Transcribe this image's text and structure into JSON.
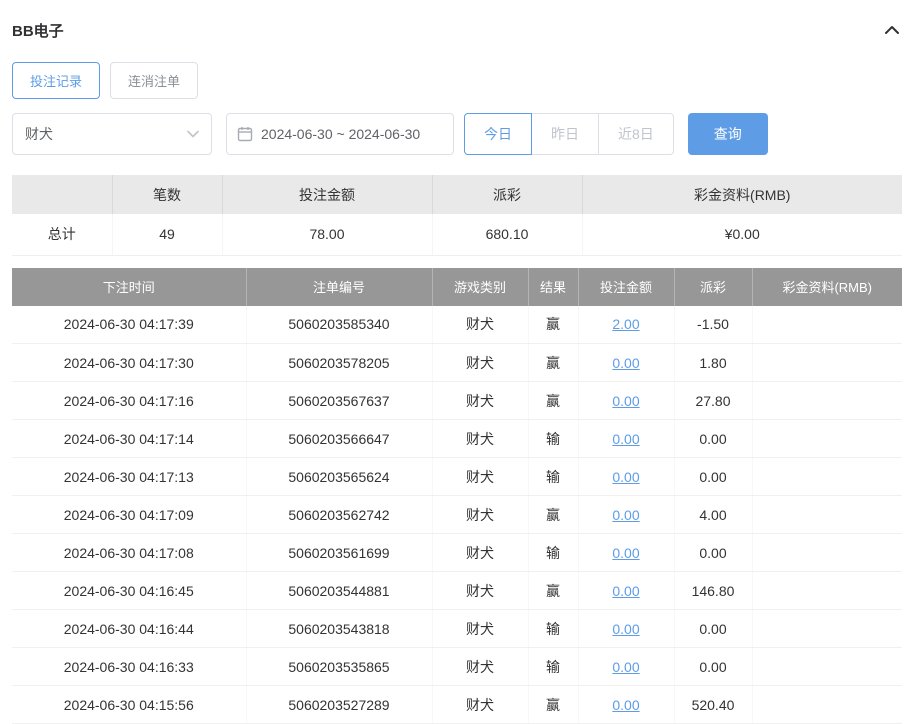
{
  "page": {
    "title": "BB电子"
  },
  "icons": {
    "collapse": "chevron-up",
    "calendar": "calendar",
    "select_arrow": "chevron-down"
  },
  "colors": {
    "accent": "#5e9de6",
    "negative": "#e05c5c",
    "table_header_bg": "#979797"
  },
  "tabs": [
    {
      "label": "投注记录",
      "active": true
    },
    {
      "label": "连消注单",
      "active": false
    }
  ],
  "filters": {
    "game_select": {
      "value": "财犬"
    },
    "date_range": {
      "value": "2024-06-30 ~ 2024-06-30"
    },
    "quick_buttons": [
      {
        "label": "今日",
        "active": true
      },
      {
        "label": "昨日",
        "active": false
      },
      {
        "label": "近8日",
        "active": false
      }
    ],
    "search_button": "查询"
  },
  "summary": {
    "headers": [
      "",
      "笔数",
      "投注金额",
      "派彩",
      "彩金资料(RMB)"
    ],
    "total": {
      "label": "总计",
      "count": "49",
      "bet_amount": "78.00",
      "payout": "680.10",
      "bonus": "¥0.00"
    }
  },
  "table": {
    "headers": [
      "下注时间",
      "注单编号",
      "游戏类别",
      "结果",
      "投注金额",
      "派彩",
      "彩金资料(RMB)"
    ],
    "rows": [
      {
        "time": "2024-06-30 04:17:39",
        "order_id": "5060203585340",
        "game": "财犬",
        "result": "赢",
        "bet": "2.00",
        "payout": "-1.50",
        "bonus": ""
      },
      {
        "time": "2024-06-30 04:17:30",
        "order_id": "5060203578205",
        "game": "财犬",
        "result": "赢",
        "bet": "0.00",
        "payout": "1.80",
        "bonus": ""
      },
      {
        "time": "2024-06-30 04:17:16",
        "order_id": "5060203567637",
        "game": "财犬",
        "result": "赢",
        "bet": "0.00",
        "payout": "27.80",
        "bonus": ""
      },
      {
        "time": "2024-06-30 04:17:14",
        "order_id": "5060203566647",
        "game": "财犬",
        "result": "输",
        "bet": "0.00",
        "payout": "0.00",
        "bonus": ""
      },
      {
        "time": "2024-06-30 04:17:13",
        "order_id": "5060203565624",
        "game": "财犬",
        "result": "输",
        "bet": "0.00",
        "payout": "0.00",
        "bonus": ""
      },
      {
        "time": "2024-06-30 04:17:09",
        "order_id": "5060203562742",
        "game": "财犬",
        "result": "赢",
        "bet": "0.00",
        "payout": "4.00",
        "bonus": ""
      },
      {
        "time": "2024-06-30 04:17:08",
        "order_id": "5060203561699",
        "game": "财犬",
        "result": "输",
        "bet": "0.00",
        "payout": "0.00",
        "bonus": ""
      },
      {
        "time": "2024-06-30 04:16:45",
        "order_id": "5060203544881",
        "game": "财犬",
        "result": "赢",
        "bet": "0.00",
        "payout": "146.80",
        "bonus": ""
      },
      {
        "time": "2024-06-30 04:16:44",
        "order_id": "5060203543818",
        "game": "财犬",
        "result": "输",
        "bet": "0.00",
        "payout": "0.00",
        "bonus": ""
      },
      {
        "time": "2024-06-30 04:16:33",
        "order_id": "5060203535865",
        "game": "财犬",
        "result": "输",
        "bet": "0.00",
        "payout": "0.00",
        "bonus": ""
      },
      {
        "time": "2024-06-30 04:15:56",
        "order_id": "5060203527289",
        "game": "财犬",
        "result": "赢",
        "bet": "0.00",
        "payout": "520.40",
        "bonus": ""
      }
    ]
  }
}
